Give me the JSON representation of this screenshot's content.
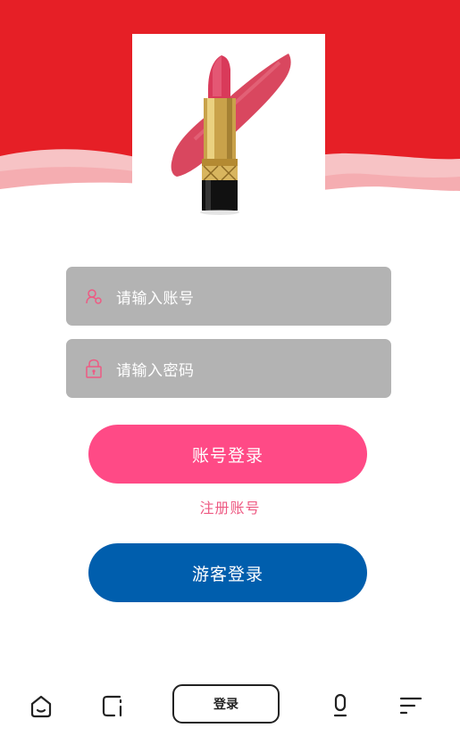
{
  "colors": {
    "header_red": "#e61f26",
    "wave_pink_light": "#f7c3c5",
    "wave_pink": "#f4a9ad",
    "input_bg": "#b3b3b3",
    "icon_pink": "#ee5a83",
    "login_button": "#ff4a86",
    "register_link": "#ee5a83",
    "guest_button": "#005ead",
    "nav_dark": "#222222"
  },
  "header": {
    "image_icon": "lipstick-image"
  },
  "form": {
    "account": {
      "icon": "user-icon",
      "placeholder": "请输入账号"
    },
    "password": {
      "icon": "lock-icon",
      "placeholder": "请输入密码"
    },
    "login_button": "账号登录",
    "register_link": "注册账号",
    "guest_button": "游客登录"
  },
  "nav": {
    "home_icon": "home-icon",
    "window_icon": "window-icon",
    "center_label": "登录",
    "mic_icon": "mic-icon",
    "menu_icon": "menu-icon"
  }
}
